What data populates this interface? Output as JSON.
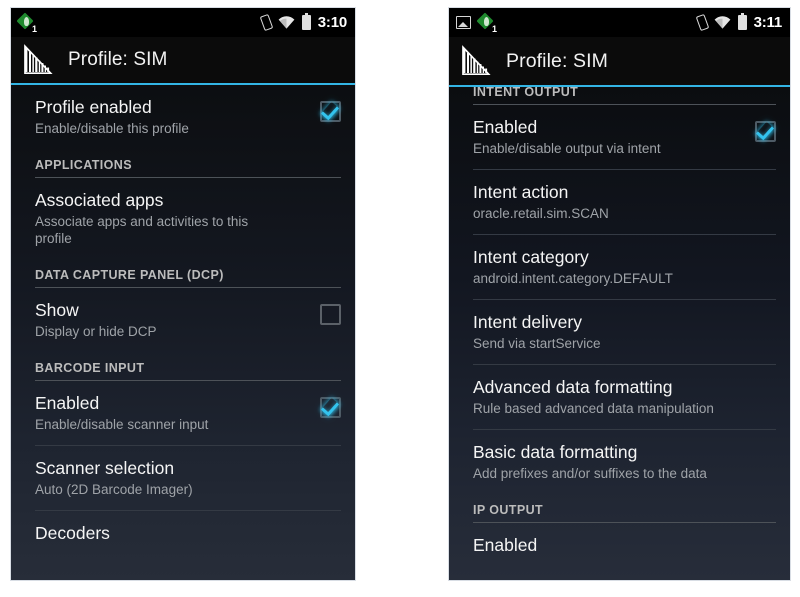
{
  "meta": {
    "accent_color": "#33b5e5",
    "checkbox_check_color": "#33c3ee",
    "notification_badge": "1"
  },
  "left_phone": {
    "statusbar": {
      "icons_left": [
        "profile-notification-icon"
      ],
      "icons_right": [
        "vibrate-icon",
        "wifi-icon",
        "battery-icon"
      ],
      "clock": "3:10"
    },
    "actionbar": {
      "app_icon": "barcode-app-icon",
      "title": "Profile: SIM"
    },
    "items": [
      {
        "kind": "pref",
        "title": "Profile enabled",
        "summary": "Enable/disable this profile",
        "widget": "checkbox",
        "checked": true
      },
      {
        "kind": "section",
        "title": "APPLICATIONS"
      },
      {
        "kind": "pref",
        "title": "Associated apps",
        "summary": "Associate apps and activities to this profile",
        "widget": "none"
      },
      {
        "kind": "section",
        "title": "DATA CAPTURE PANEL (DCP)"
      },
      {
        "kind": "pref",
        "title": "Show",
        "summary": "Display or hide DCP",
        "widget": "checkbox",
        "checked": false
      },
      {
        "kind": "section",
        "title": "BARCODE INPUT"
      },
      {
        "kind": "pref",
        "title": "Enabled",
        "summary": "Enable/disable scanner input",
        "widget": "checkbox",
        "checked": true
      },
      {
        "kind": "pref",
        "title": "Scanner selection",
        "summary": "Auto (2D Barcode Imager)",
        "widget": "none"
      },
      {
        "kind": "pref",
        "title": "Decoders",
        "summary": "",
        "widget": "none"
      }
    ]
  },
  "right_phone": {
    "statusbar": {
      "icons_left": [
        "screenshot-icon",
        "profile-notification-icon"
      ],
      "icons_right": [
        "vibrate-icon",
        "wifi-icon",
        "battery-icon"
      ],
      "clock": "3:11"
    },
    "actionbar": {
      "app_icon": "barcode-app-icon",
      "title": "Profile: SIM"
    },
    "items": [
      {
        "kind": "section",
        "title": "INTENT OUTPUT",
        "clipped": true
      },
      {
        "kind": "pref",
        "title": "Enabled",
        "summary": "Enable/disable output via intent",
        "widget": "checkbox",
        "checked": true
      },
      {
        "kind": "pref",
        "title": "Intent action",
        "summary": "oracle.retail.sim.SCAN",
        "widget": "none"
      },
      {
        "kind": "pref",
        "title": "Intent category",
        "summary": "android.intent.category.DEFAULT",
        "widget": "none"
      },
      {
        "kind": "pref",
        "title": "Intent delivery",
        "summary": "Send via startService",
        "widget": "none"
      },
      {
        "kind": "pref",
        "title": "Advanced data formatting",
        "summary": "Rule based advanced data manipulation",
        "widget": "none"
      },
      {
        "kind": "pref",
        "title": "Basic data formatting",
        "summary": "Add prefixes and/or suffixes to the data",
        "widget": "none"
      },
      {
        "kind": "section",
        "title": "IP OUTPUT"
      },
      {
        "kind": "pref",
        "title": "Enabled",
        "summary": "",
        "widget": "none",
        "clipped": true
      }
    ]
  }
}
